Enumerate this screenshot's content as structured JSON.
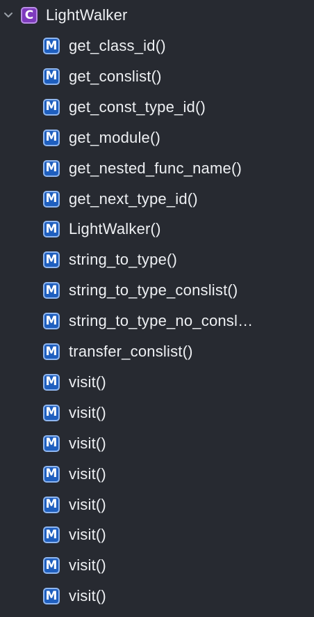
{
  "class_node": {
    "badge": "C",
    "name": "LightWalker",
    "expanded": true,
    "chevron_icon": "chevron-down-icon"
  },
  "badge_colors": {
    "class_fill": "#7e3bbd",
    "class_border": "#b98de6",
    "method_fill": "#1f5fbf",
    "method_border": "#8fb6ef",
    "background": "#272a31"
  },
  "methods": [
    {
      "badge": "M",
      "name": "get_class_id()"
    },
    {
      "badge": "M",
      "name": "get_conslist()"
    },
    {
      "badge": "M",
      "name": "get_const_type_id()"
    },
    {
      "badge": "M",
      "name": "get_module()"
    },
    {
      "badge": "M",
      "name": "get_nested_func_name()"
    },
    {
      "badge": "M",
      "name": "get_next_type_id()"
    },
    {
      "badge": "M",
      "name": "LightWalker()"
    },
    {
      "badge": "M",
      "name": "string_to_type()"
    },
    {
      "badge": "M",
      "name": "string_to_type_conslist()"
    },
    {
      "badge": "M",
      "name": "string_to_type_no_consl…"
    },
    {
      "badge": "M",
      "name": "transfer_conslist()"
    },
    {
      "badge": "M",
      "name": "visit()"
    },
    {
      "badge": "M",
      "name": "visit()"
    },
    {
      "badge": "M",
      "name": "visit()"
    },
    {
      "badge": "M",
      "name": "visit()"
    },
    {
      "badge": "M",
      "name": "visit()"
    },
    {
      "badge": "M",
      "name": "visit()"
    },
    {
      "badge": "M",
      "name": "visit()"
    },
    {
      "badge": "M",
      "name": "visit()"
    }
  ]
}
